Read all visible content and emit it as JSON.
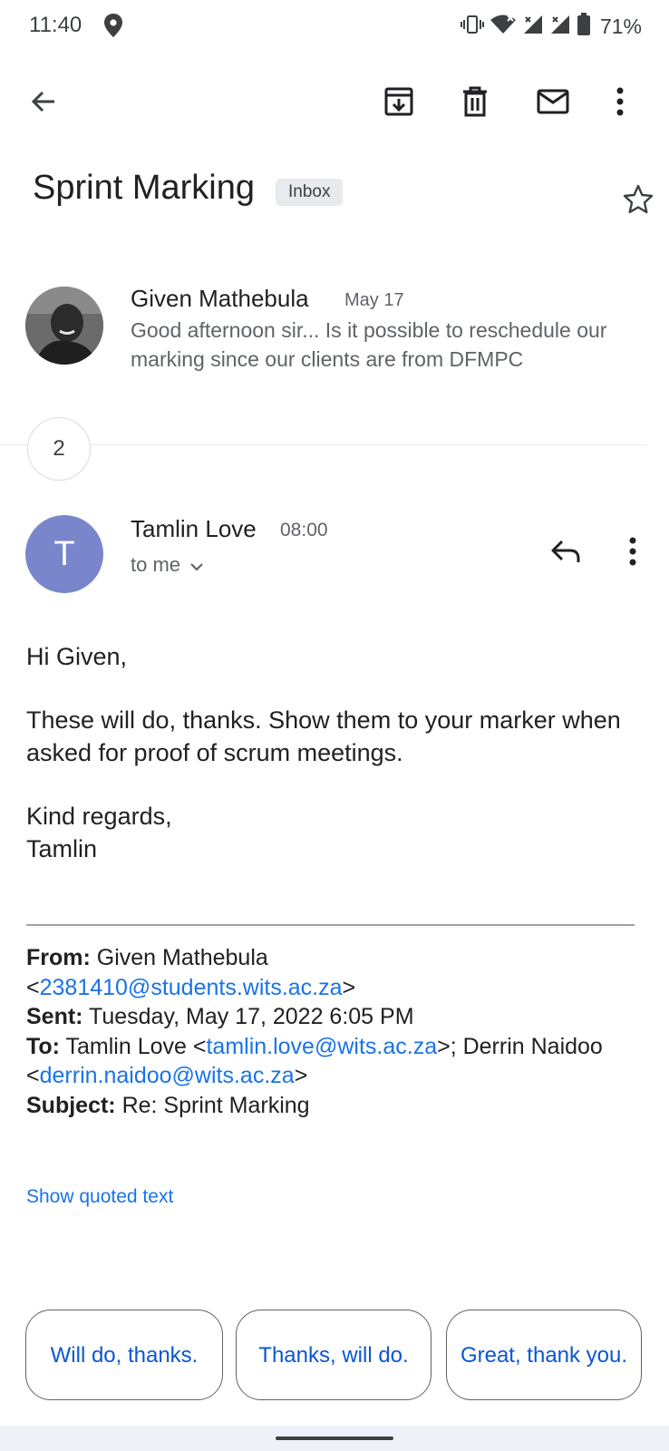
{
  "status_bar": {
    "time": "11:40",
    "battery": "71%",
    "icons": [
      "location-icon",
      "vibrate-icon",
      "wifi-icon",
      "signal-icon",
      "signal-icon",
      "battery-icon"
    ]
  },
  "toolbar": {
    "icons": [
      "back-arrow-icon",
      "archive-icon",
      "delete-icon",
      "mark-unread-icon",
      "more-vert-icon"
    ]
  },
  "thread": {
    "subject": "Sprint Marking",
    "label": "Inbox"
  },
  "message_1": {
    "sender": "Given Mathebula",
    "date": "May 17",
    "snippet": "Good afternoon sir... Is it possible to reschedule our marking since our clients are from DFMPC"
  },
  "collapsed_count": "2",
  "message_2": {
    "avatar_letter": "T",
    "avatar_color": "#7986cb",
    "sender": "Tamlin Love",
    "time": "08:00",
    "recipient": "to me",
    "greeting": "Hi Given,",
    "paragraph": "These will do, thanks. Show them to your marker when asked for proof of scrum meetings.",
    "closing": "Kind regards,",
    "signature": "Tamlin"
  },
  "quoted_header": {
    "from_label": "From:",
    "from_name": " Given Mathebula",
    "from_open": "<",
    "from_email": "2381410@students.wits.ac.za",
    "from_close": ">",
    "sent_label": "Sent:",
    "sent_value": " Tuesday, May 17, 2022 6:05 PM",
    "to_label": "To:",
    "to_name_1": " Tamlin Love <",
    "to_email_1": "tamlin.love@wits.ac.za",
    "to_sep": ">; Derrin Naidoo <",
    "to_email_2": "derrin.naidoo@wits.ac.za",
    "to_close": ">",
    "subject_label": "Subject:",
    "subject_value": " Re: Sprint Marking"
  },
  "show_quoted": "Show quoted text",
  "smart_replies": [
    "Will do, thanks.",
    "Thanks, will do.",
    "Great, thank you."
  ],
  "colors": {
    "link": "#1a73e8",
    "chip_text": "#0b57d0"
  }
}
